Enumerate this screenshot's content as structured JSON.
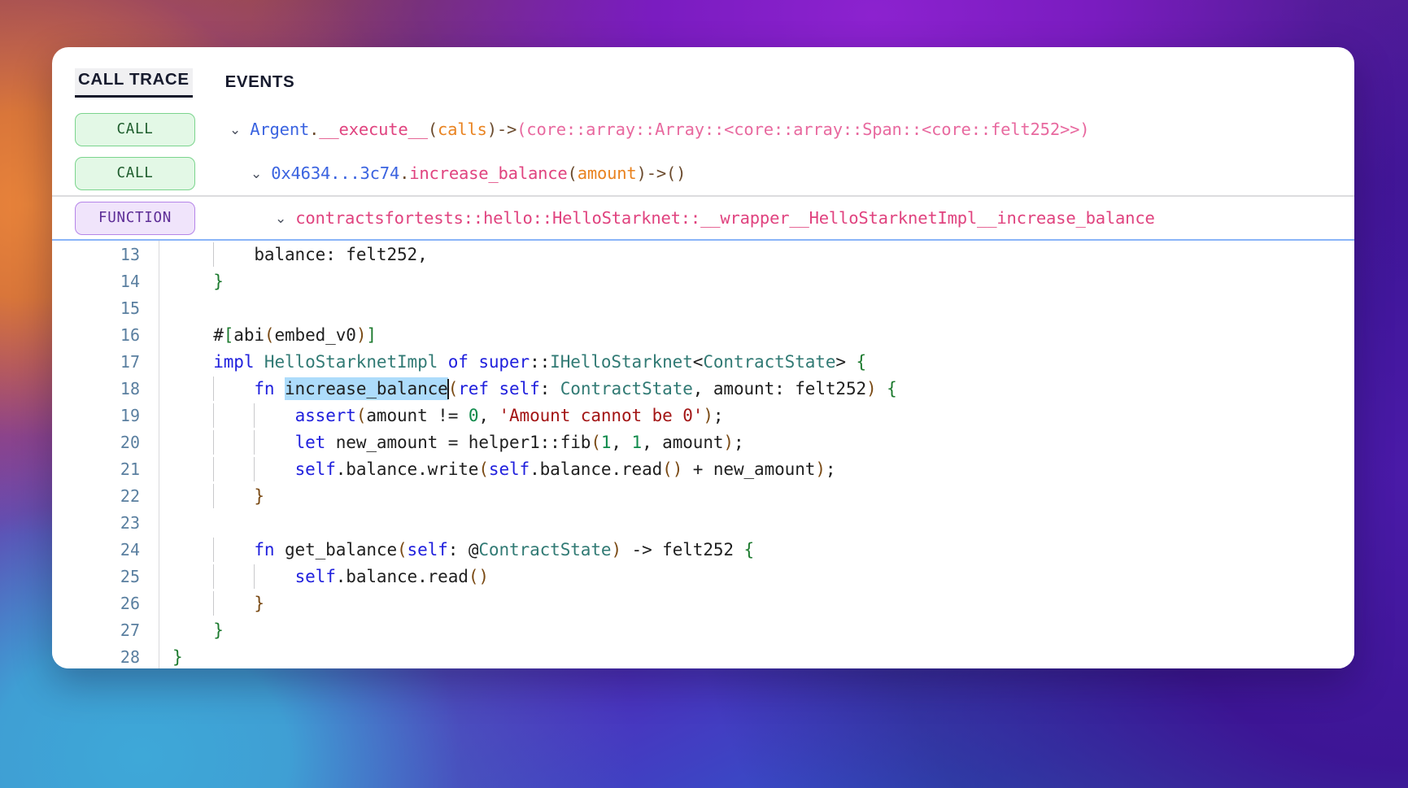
{
  "colors": {
    "accent_blue": "#3a63e0",
    "method_pink": "#e0437f",
    "param_orange": "#e98320",
    "call_badge_bg": "#e3f8e6",
    "call_badge_text": "#1d5c2c",
    "function_badge_bg": "#f0e4fb",
    "function_badge_text": "#5d2d96",
    "selection": "#addcfb",
    "linenum": "#5a7fa0"
  },
  "tabs": [
    {
      "label": "CALL TRACE",
      "active": true
    },
    {
      "label": "EVENTS",
      "active": false
    }
  ],
  "trace": {
    "rows": [
      {
        "badge": "CALL",
        "kind": "call",
        "chevron": "⌄",
        "object": "Argent",
        "dot": ".",
        "method": "__execute__",
        "open": "(",
        "arg": "calls",
        "close": ")",
        "arrow": "->",
        "returns": "(core::array::Array::<core::array::Span::<core::felt252>>)"
      },
      {
        "badge": "CALL",
        "kind": "call",
        "chevron": "⌄",
        "object": "0x4634...3c74",
        "dot": ".",
        "method": "increase_balance",
        "open": "(",
        "arg": "amount",
        "close": ")",
        "arrow": "->",
        "returns": "()"
      },
      {
        "badge": "FUNCTION",
        "kind": "function",
        "chevron": "⌄",
        "path": "contractsfortests::hello::HelloStarknet::__wrapper__HelloStarknetImpl__increase_balance"
      }
    ]
  },
  "editor": {
    "lines": [
      {
        "num": "13",
        "indent": 2,
        "tokens": [
          {
            "t": "balance",
            "c": "pl"
          },
          {
            "t": ": ",
            "c": "pl"
          },
          {
            "t": "felt252",
            "c": "pl"
          },
          {
            "t": ",",
            "c": "pl"
          }
        ]
      },
      {
        "num": "14",
        "indent": 1,
        "tokens": [
          {
            "t": "}",
            "c": "gr"
          }
        ]
      },
      {
        "num": "15",
        "indent": 0,
        "tokens": []
      },
      {
        "num": "16",
        "indent": 1,
        "tokens": [
          {
            "t": "#",
            "c": "pl"
          },
          {
            "t": "[",
            "c": "gr"
          },
          {
            "t": "abi",
            "c": "pl"
          },
          {
            "t": "(",
            "c": "pn"
          },
          {
            "t": "embed_v0",
            "c": "pl"
          },
          {
            "t": ")",
            "c": "pn"
          },
          {
            "t": "]",
            "c": "gr"
          }
        ]
      },
      {
        "num": "17",
        "indent": 1,
        "tokens": [
          {
            "t": "impl",
            "c": "k"
          },
          {
            "t": " ",
            "c": "pl"
          },
          {
            "t": "HelloStarknetImpl",
            "c": "ty"
          },
          {
            "t": " ",
            "c": "pl"
          },
          {
            "t": "of",
            "c": "k"
          },
          {
            "t": " ",
            "c": "pl"
          },
          {
            "t": "super",
            "c": "k"
          },
          {
            "t": "::",
            "c": "pl"
          },
          {
            "t": "IHelloStarknet",
            "c": "ty"
          },
          {
            "t": "<",
            "c": "pl"
          },
          {
            "t": "ContractState",
            "c": "ty"
          },
          {
            "t": "> ",
            "c": "pl"
          },
          {
            "t": "{",
            "c": "gr"
          }
        ]
      },
      {
        "num": "18",
        "indent": 2,
        "tokens": [
          {
            "t": "fn",
            "c": "k"
          },
          {
            "t": " ",
            "c": "pl"
          },
          {
            "t": "increase_balance",
            "c": "pl",
            "sel": true
          },
          {
            "t": "CARET",
            "c": "caret"
          },
          {
            "t": "(",
            "c": "pn"
          },
          {
            "t": "ref",
            "c": "k"
          },
          {
            "t": " ",
            "c": "pl"
          },
          {
            "t": "self",
            "c": "k"
          },
          {
            "t": ": ",
            "c": "pl"
          },
          {
            "t": "ContractState",
            "c": "ty"
          },
          {
            "t": ", amount: felt252",
            "c": "pl"
          },
          {
            "t": ")",
            "c": "pn"
          },
          {
            "t": " ",
            "c": "pl"
          },
          {
            "t": "{",
            "c": "gr"
          }
        ]
      },
      {
        "num": "19",
        "indent": 3,
        "tokens": [
          {
            "t": "assert",
            "c": "k"
          },
          {
            "t": "(",
            "c": "pn"
          },
          {
            "t": "amount != ",
            "c": "pl"
          },
          {
            "t": "0",
            "c": "num"
          },
          {
            "t": ", ",
            "c": "pl"
          },
          {
            "t": "'Amount cannot be 0'",
            "c": "str"
          },
          {
            "t": ")",
            "c": "pn"
          },
          {
            "t": ";",
            "c": "pl"
          }
        ]
      },
      {
        "num": "20",
        "indent": 3,
        "tokens": [
          {
            "t": "let",
            "c": "k"
          },
          {
            "t": " new_amount = helper1::fib",
            "c": "pl"
          },
          {
            "t": "(",
            "c": "pn"
          },
          {
            "t": "1",
            "c": "num"
          },
          {
            "t": ", ",
            "c": "pl"
          },
          {
            "t": "1",
            "c": "num"
          },
          {
            "t": ", amount",
            "c": "pl"
          },
          {
            "t": ")",
            "c": "pn"
          },
          {
            "t": ";",
            "c": "pl"
          }
        ]
      },
      {
        "num": "21",
        "indent": 3,
        "tokens": [
          {
            "t": "self",
            "c": "k"
          },
          {
            "t": ".balance.write",
            "c": "pl"
          },
          {
            "t": "(",
            "c": "pn"
          },
          {
            "t": "self",
            "c": "k"
          },
          {
            "t": ".balance.read",
            "c": "pl"
          },
          {
            "t": "()",
            "c": "pn"
          },
          {
            "t": " + new_amount",
            "c": "pl"
          },
          {
            "t": ")",
            "c": "pn"
          },
          {
            "t": ";",
            "c": "pl"
          }
        ]
      },
      {
        "num": "22",
        "indent": 2,
        "tokens": [
          {
            "t": "}",
            "c": "pn"
          }
        ]
      },
      {
        "num": "23",
        "indent": 0,
        "tokens": []
      },
      {
        "num": "24",
        "indent": 2,
        "tokens": [
          {
            "t": "fn",
            "c": "k"
          },
          {
            "t": " get_balance",
            "c": "pl"
          },
          {
            "t": "(",
            "c": "pn"
          },
          {
            "t": "self",
            "c": "k"
          },
          {
            "t": ": @",
            "c": "pl"
          },
          {
            "t": "ContractState",
            "c": "ty"
          },
          {
            "t": ")",
            "c": "pn"
          },
          {
            "t": " -> felt252 ",
            "c": "pl"
          },
          {
            "t": "{",
            "c": "gr"
          }
        ]
      },
      {
        "num": "25",
        "indent": 3,
        "tokens": [
          {
            "t": "self",
            "c": "k"
          },
          {
            "t": ".balance.read",
            "c": "pl"
          },
          {
            "t": "()",
            "c": "pn"
          }
        ]
      },
      {
        "num": "26",
        "indent": 2,
        "tokens": [
          {
            "t": "}",
            "c": "pn"
          }
        ]
      },
      {
        "num": "27",
        "indent": 1,
        "tokens": [
          {
            "t": "}",
            "c": "gr"
          }
        ]
      },
      {
        "num": "28",
        "indent": 0,
        "tokens": [
          {
            "t": "}",
            "c": "gr"
          }
        ]
      }
    ]
  }
}
